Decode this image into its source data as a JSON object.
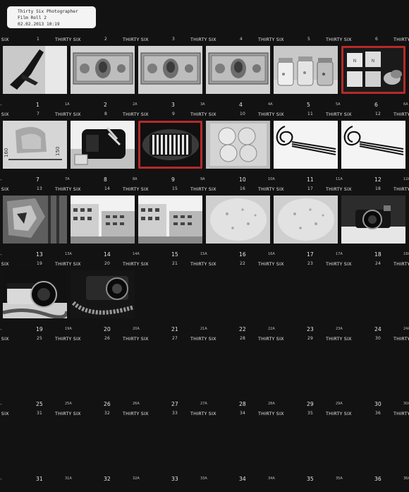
{
  "label": {
    "line1": "Thirty Six Photographer",
    "line2": "Film Roll 2",
    "line3": "02.02.2013 10:19"
  },
  "brand": "THIRTY SIX",
  "strips": [
    {
      "top_numbers": [
        "1",
        "2",
        "3",
        "4",
        "5",
        "6"
      ],
      "bottom_numbers": [
        "1",
        "2",
        "3",
        "4",
        "5",
        "6"
      ],
      "bottom_half": [
        "1A",
        "2A",
        "3A",
        "4A",
        "5A",
        "6A"
      ],
      "frames": [
        {
          "subject": "high-heel-shoe",
          "selected": false
        },
        {
          "subject": "dollar-bill",
          "selected": false
        },
        {
          "subject": "dollar-bill",
          "selected": false
        },
        {
          "subject": "dollar-bill",
          "selected": false
        },
        {
          "subject": "pill-jars",
          "selected": false
        },
        {
          "subject": "capsule-boxes",
          "selected": true
        }
      ]
    },
    {
      "top_numbers": [
        "7",
        "8",
        "9",
        "10",
        "11",
        "12"
      ],
      "bottom_numbers": [
        "7",
        "8",
        "9",
        "10",
        "11",
        "12"
      ],
      "bottom_half": [
        "7A",
        "8A",
        "9A",
        "10A",
        "11A",
        "12A"
      ],
      "frames": [
        {
          "subject": "scale-object",
          "selected": false
        },
        {
          "subject": "coffee-machine",
          "selected": false
        },
        {
          "subject": "coil-rings",
          "selected": true
        },
        {
          "subject": "apples",
          "selected": false
        },
        {
          "subject": "whisk-spiral",
          "selected": false
        },
        {
          "subject": "whisk-spiral",
          "selected": false
        }
      ]
    },
    {
      "top_numbers": [
        "13",
        "14",
        "15",
        "16",
        "17",
        "18"
      ],
      "bottom_numbers": [
        "13",
        "14",
        "15",
        "16",
        "17",
        "18"
      ],
      "bottom_half": [
        "13A",
        "14A",
        "15A",
        "16A",
        "17A",
        "18A"
      ],
      "frames": [
        {
          "subject": "wooden-crate",
          "selected": false
        },
        {
          "subject": "buildings",
          "selected": false
        },
        {
          "subject": "buildings",
          "selected": false
        },
        {
          "subject": "tortilla",
          "selected": false
        },
        {
          "subject": "tortilla",
          "selected": false
        },
        {
          "subject": "camera",
          "selected": false
        }
      ]
    },
    {
      "top_numbers": [
        "19",
        "20",
        "21",
        "22",
        "23",
        "24"
      ],
      "bottom_numbers": [
        "19",
        "20",
        "21",
        "22",
        "23",
        "24"
      ],
      "bottom_half": [
        "19A",
        "20A",
        "21A",
        "22A",
        "23A",
        "24A"
      ],
      "frames": [
        {
          "subject": "camera-lens",
          "selected": false
        },
        {
          "subject": "camera-strap",
          "selected": false
        }
      ]
    },
    {
      "top_numbers": [
        "25",
        "26",
        "27",
        "28",
        "29",
        "30"
      ],
      "bottom_numbers": [
        "25",
        "26",
        "27",
        "28",
        "29",
        "30"
      ],
      "bottom_half": [
        "25A",
        "26A",
        "27A",
        "28A",
        "29A",
        "30A"
      ],
      "frames": []
    },
    {
      "top_numbers": [
        "31",
        "32",
        "33",
        "34",
        "35",
        "36"
      ],
      "bottom_numbers": [
        "31",
        "32",
        "33",
        "34",
        "35",
        "36"
      ],
      "bottom_half": [
        "31A",
        "32A",
        "33A",
        "34A",
        "35A",
        "36A"
      ],
      "frames": []
    }
  ]
}
